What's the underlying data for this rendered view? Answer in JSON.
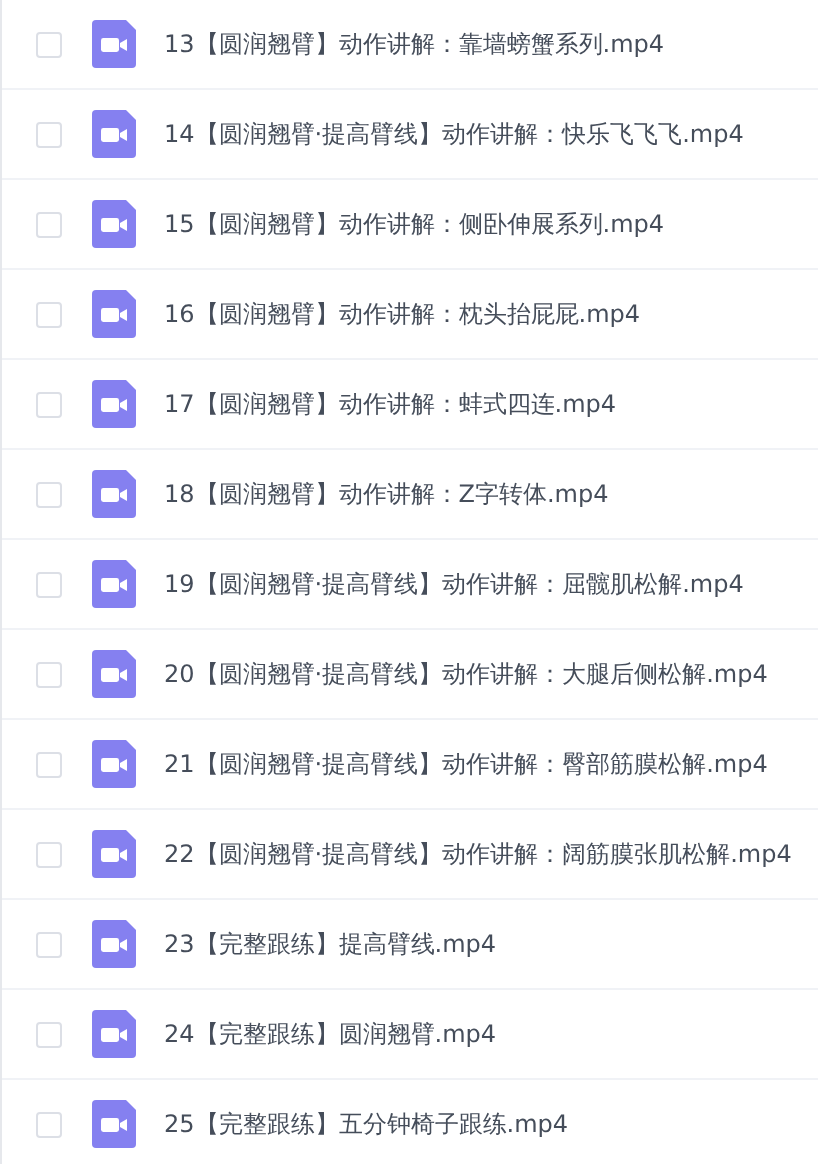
{
  "files": [
    {
      "name": "13【圆润翘臂】动作讲解：靠墙螃蟹系列.mp4",
      "checked": false
    },
    {
      "name": "14【圆润翘臂·提高臂线】动作讲解：快乐飞飞飞.mp4",
      "checked": false
    },
    {
      "name": "15【圆润翘臂】动作讲解：侧卧伸展系列.mp4",
      "checked": false
    },
    {
      "name": "16【圆润翘臂】动作讲解：枕头抬屁屁.mp4",
      "checked": false
    },
    {
      "name": "17【圆润翘臂】动作讲解：蚌式四连.mp4",
      "checked": false
    },
    {
      "name": "18【圆润翘臂】动作讲解：Z字转体.mp4",
      "checked": false
    },
    {
      "name": "19【圆润翘臂·提高臂线】动作讲解：屈髋肌松解.mp4",
      "checked": false
    },
    {
      "name": "20【圆润翘臂·提高臂线】动作讲解：大腿后侧松解.mp4",
      "checked": false
    },
    {
      "name": "21【圆润翘臂·提高臂线】动作讲解：臀部筋膜松解.mp4",
      "checked": false
    },
    {
      "name": "22【圆润翘臂·提高臂线】动作讲解：阔筋膜张肌松解.mp4",
      "checked": false
    },
    {
      "name": "23【完整跟练】提高臂线.mp4",
      "checked": false
    },
    {
      "name": "24【完整跟练】圆润翘臂.mp4",
      "checked": false
    },
    {
      "name": "25【完整跟练】五分钟椅子跟练.mp4",
      "checked": false
    }
  ]
}
